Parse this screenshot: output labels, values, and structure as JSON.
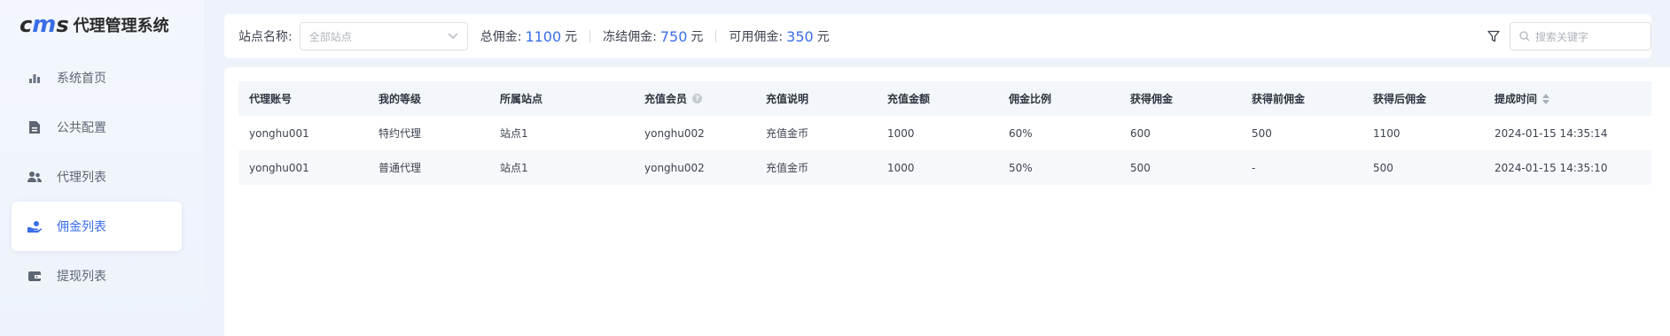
{
  "app": {
    "logo_mark_left": "c",
    "logo_mark_mid": "m",
    "logo_mark_right": "s",
    "title": "代理管理系统"
  },
  "colors": {
    "accent": "#3a6ee8",
    "sidebar_bg": "#f3f7fd",
    "text": "#3d4350"
  },
  "sidebar": {
    "items": [
      {
        "label": "系统首页",
        "icon": "bar-chart-icon",
        "active": false
      },
      {
        "label": "公共配置",
        "icon": "document-icon",
        "active": false
      },
      {
        "label": "代理列表",
        "icon": "users-icon",
        "active": false
      },
      {
        "label": "佣金列表",
        "icon": "hand-coin-icon",
        "active": true
      },
      {
        "label": "提现列表",
        "icon": "wallet-icon",
        "active": false
      }
    ]
  },
  "filter": {
    "site_label": "站点名称:",
    "site_placeholder": "全部站点",
    "total_label": "总佣金:",
    "total_value": "1100",
    "frozen_label": "冻结佣金:",
    "frozen_value": "750",
    "available_label": "可用佣金:",
    "available_value": "350",
    "unit": "元",
    "search_placeholder": "搜索关键字"
  },
  "table": {
    "headers": [
      "代理账号",
      "我的等级",
      "所属站点",
      "充值会员",
      "充值说明",
      "充值金额",
      "佣金比例",
      "获得佣金",
      "获得前佣金",
      "获得后佣金",
      "提成时间"
    ],
    "rows": [
      [
        "yonghu001",
        "特约代理",
        "站点1",
        "yonghu002",
        "充值金币",
        "1000",
        "60%",
        "600",
        "500",
        "1100",
        "2024-01-15 14:35:14"
      ],
      [
        "yonghu001",
        "普通代理",
        "站点1",
        "yonghu002",
        "充值金币",
        "1000",
        "50%",
        "500",
        "-",
        "500",
        "2024-01-15 14:35:10"
      ]
    ]
  }
}
